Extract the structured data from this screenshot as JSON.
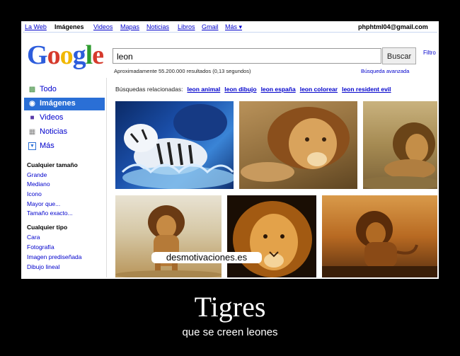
{
  "topnav": {
    "items": [
      "La Web",
      "Imágenes",
      "Videos",
      "Mapas",
      "Noticias",
      "Libros",
      "Gmail",
      "Más ▾"
    ],
    "email": "phphtml04@gmail.com"
  },
  "logo": [
    "G",
    "o",
    "o",
    "g",
    "l",
    "e"
  ],
  "search": {
    "value": "leon",
    "button": "Buscar",
    "filter": "Filtro"
  },
  "results_info": "Aproximadamente 55.200.000 resultados (0,13 segundos)",
  "advanced_search": "Búsqueda avanzada",
  "sidebar": {
    "nav": [
      {
        "label": "Todo",
        "icon": "todo-icon"
      },
      {
        "label": "Imágenes",
        "icon": "images-icon"
      },
      {
        "label": "Videos",
        "icon": "videos-icon"
      },
      {
        "label": "Noticias",
        "icon": "news-icon"
      },
      {
        "label": "Más",
        "icon": "more-icon"
      }
    ],
    "size_title": "Cualquier tamaño",
    "size_options": [
      "Grande",
      "Mediano",
      "Icono",
      "Mayor que...",
      "Tamaño exacto..."
    ],
    "type_title": "Cualquier tipo",
    "type_options": [
      "Cara",
      "Fotografía",
      "Imagen prediseñada",
      "Dibujo lineal"
    ]
  },
  "related": {
    "label": "Búsquedas relacionadas:",
    "links": [
      "leon animal",
      "leon dibujo",
      "leon españa",
      "leon colorear",
      "leon resident evil"
    ]
  },
  "thumbnails": [
    "white-tiger-water",
    "lion-lying-closeup",
    "lion-resting-grass",
    "lion-walking-savanna",
    "lion-face-portrait",
    "lion-roaring-sunset"
  ],
  "watermark": "desmotivaciones.es",
  "poster": {
    "title": "Tigres",
    "subtitle": "que se creen leones"
  },
  "colors": {
    "accent": "#2a6fd6",
    "link": "#0000cc",
    "background": "#000000"
  }
}
